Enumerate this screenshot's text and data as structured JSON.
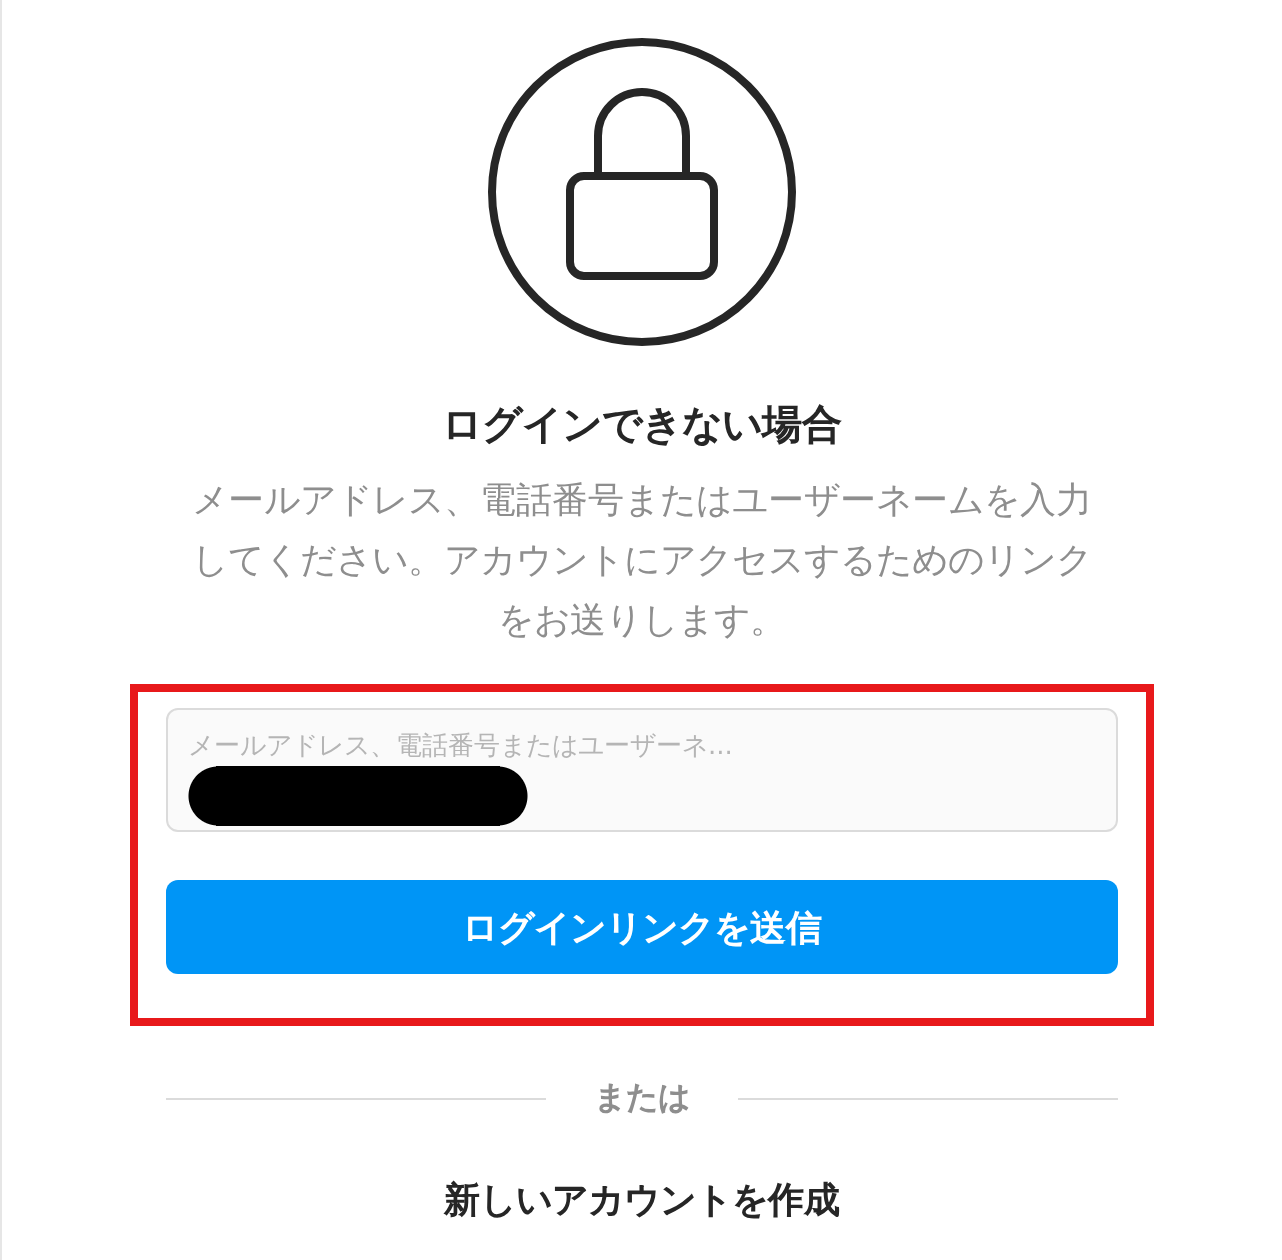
{
  "title": "ログインできない場合",
  "description": "メールアドレス、電話番号またはユーザーネームを入力してください。アカウントにアクセスするためのリンクをお送りします。",
  "form": {
    "highlighted": true,
    "redacted": true,
    "field": {
      "placeholder": "メールアドレス、電話番号またはユーザーネ..."
    },
    "submit": "ログインリンクを送信"
  },
  "divider": "または",
  "create_account": "新しいアカウントを作成"
}
